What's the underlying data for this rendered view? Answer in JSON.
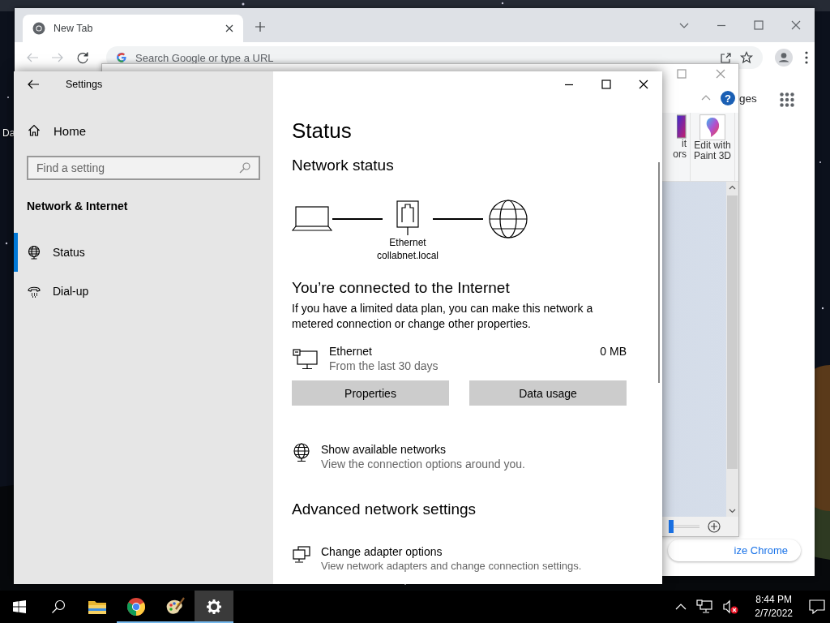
{
  "desktop": {
    "icon_label": "Da"
  },
  "browser": {
    "tabs": [
      {
        "label": "New Tab",
        "selected": true
      }
    ],
    "address_placeholder": "Search Google or type a URL",
    "link_fragment": "ges",
    "customize_fragment": "ize Chrome"
  },
  "paint": {
    "help_glyph": "?",
    "ribbon_items": [
      {
        "lines": [
          "it",
          "ors"
        ],
        "kind": "colors"
      },
      {
        "lines": [
          "Edit with",
          "Paint 3D"
        ],
        "kind": "paint3d"
      }
    ],
    "zoom": {
      "level": 0
    }
  },
  "settings": {
    "title": "Settings",
    "home": "Home",
    "search_placeholder": "Find a setting",
    "section": "Network & Internet",
    "nav": [
      {
        "label": "Status",
        "kind": "globe",
        "selected": true
      },
      {
        "label": "Dial-up",
        "kind": "phone",
        "selected": false
      }
    ],
    "page_title": "Status",
    "network_status_heading": "Network status",
    "adapter_name": "Ethernet",
    "domain": "collabnet.local",
    "connected_heading": "You’re connected to the Internet",
    "connected_text": "If you have a limited data plan, you can make this network a metered connection or change other properties.",
    "usage": {
      "name": "Ethernet",
      "period": "From the last 30 days",
      "amount": "0 MB"
    },
    "buttons": [
      "Properties",
      "Data usage"
    ],
    "links": [
      {
        "title": "Show available networks",
        "subtitle": "View the connection options around you.",
        "kind": "globe"
      }
    ],
    "advanced_heading": "Advanced network settings",
    "advanced_links": [
      {
        "title": "Change adapter options",
        "subtitle": "View network adapters and change connection settings.",
        "kind": "monitors"
      }
    ]
  },
  "taskbar": {
    "apps": [
      {
        "kind": "folder",
        "running": false,
        "selected": false
      },
      {
        "kind": "chrome",
        "running": true,
        "selected": false
      },
      {
        "kind": "paint",
        "running": true,
        "selected": false
      },
      {
        "kind": "settings",
        "running": true,
        "selected": true
      }
    ],
    "time": "8:44 PM",
    "date": "2/7/2022"
  }
}
